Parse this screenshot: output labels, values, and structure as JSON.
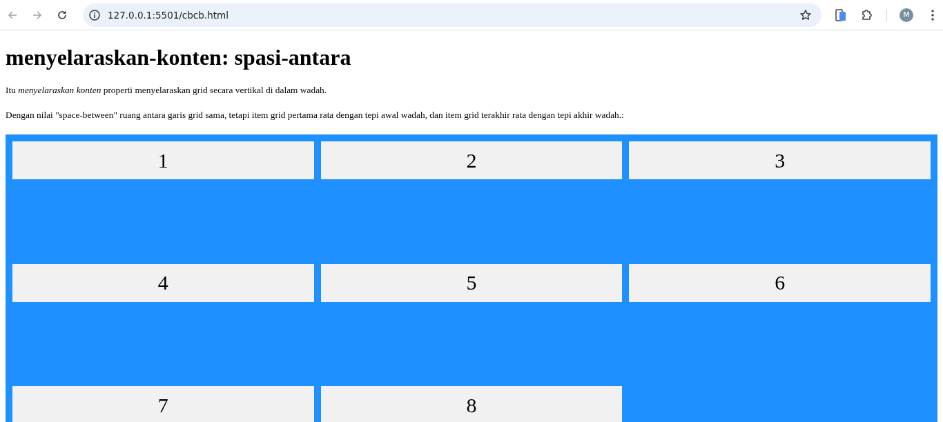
{
  "browser": {
    "url": "127.0.0.1:5501/cbcb.html",
    "profile_initial": "M"
  },
  "heading": "menyelaraskan-konten: spasi-antara",
  "paragraphs": [
    "Itu *menyelaraskan konten* properti menyelaraskan grid secara vertikal di dalam wadah.",
    "Dengan nilai \"space-between\" ruang antara garis grid sama, tetapi item grid pertama rata dengan tepi awal wadah, dan item grid terakhir rata dengan tepi akhir wadah.:"
  ],
  "grid_items": [
    "1",
    "2",
    "3",
    "4",
    "5",
    "6",
    "7",
    "8"
  ]
}
